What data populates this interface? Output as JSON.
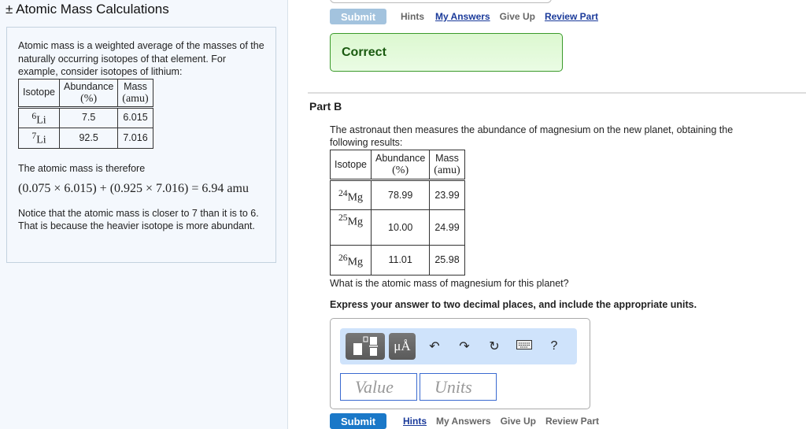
{
  "left": {
    "title": "± Atomic Mass Calculations",
    "intro": "Atomic mass is a weighted average of the masses of the naturally occurring isotopes of that element. For example, consider isotopes of lithium:",
    "table": {
      "headers": [
        "Isotope",
        "Abundance",
        "(%)",
        "Mass",
        "(amu)"
      ],
      "rows": [
        {
          "sup": "6",
          "el": "Li",
          "abundance": "7.5",
          "mass": "6.015"
        },
        {
          "sup": "7",
          "el": "Li",
          "abundance": "92.5",
          "mass": "7.016"
        }
      ]
    },
    "therefore": "The atomic mass is therefore",
    "equation": "(0.075 × 6.015) + (0.925 × 7.016) = 6.94 amu",
    "notice": "Notice that the atomic mass is closer to 7 than it is to 6. That is because the heavier isotope is more abundant."
  },
  "partA": {
    "submit": "Submit",
    "hints": "Hints",
    "my_answers": "My Answers",
    "give_up": "Give Up",
    "review_part": "Review Part",
    "feedback": "Correct"
  },
  "partB": {
    "title": "Part B",
    "prompt": "The astronaut then measures the abundance of magnesium on the new planet, obtaining the following results:",
    "table": {
      "headers": [
        "Isotope",
        "Abundance",
        "(%)",
        "Mass",
        "(amu)"
      ],
      "rows": [
        {
          "sup": "24",
          "el": "Mg",
          "abundance": "78.99",
          "mass": "23.99"
        },
        {
          "sup": "25",
          "el": "Mg",
          "abundance": "10.00",
          "mass": "24.99"
        },
        {
          "sup": "26",
          "el": "Mg",
          "abundance": "11.01",
          "mass": "25.98"
        }
      ]
    },
    "question": "What is the atomic mass of magnesium for this planet?",
    "instruction": "Express your answer to two decimal places, and include the appropriate units.",
    "toolbar": {
      "units_label": "μÅ",
      "help": "?"
    },
    "value_placeholder": "Value",
    "units_placeholder": "Units",
    "submit": "Submit",
    "hints": "Hints",
    "my_answers": "My Answers",
    "give_up": "Give Up",
    "review_part": "Review Part"
  }
}
